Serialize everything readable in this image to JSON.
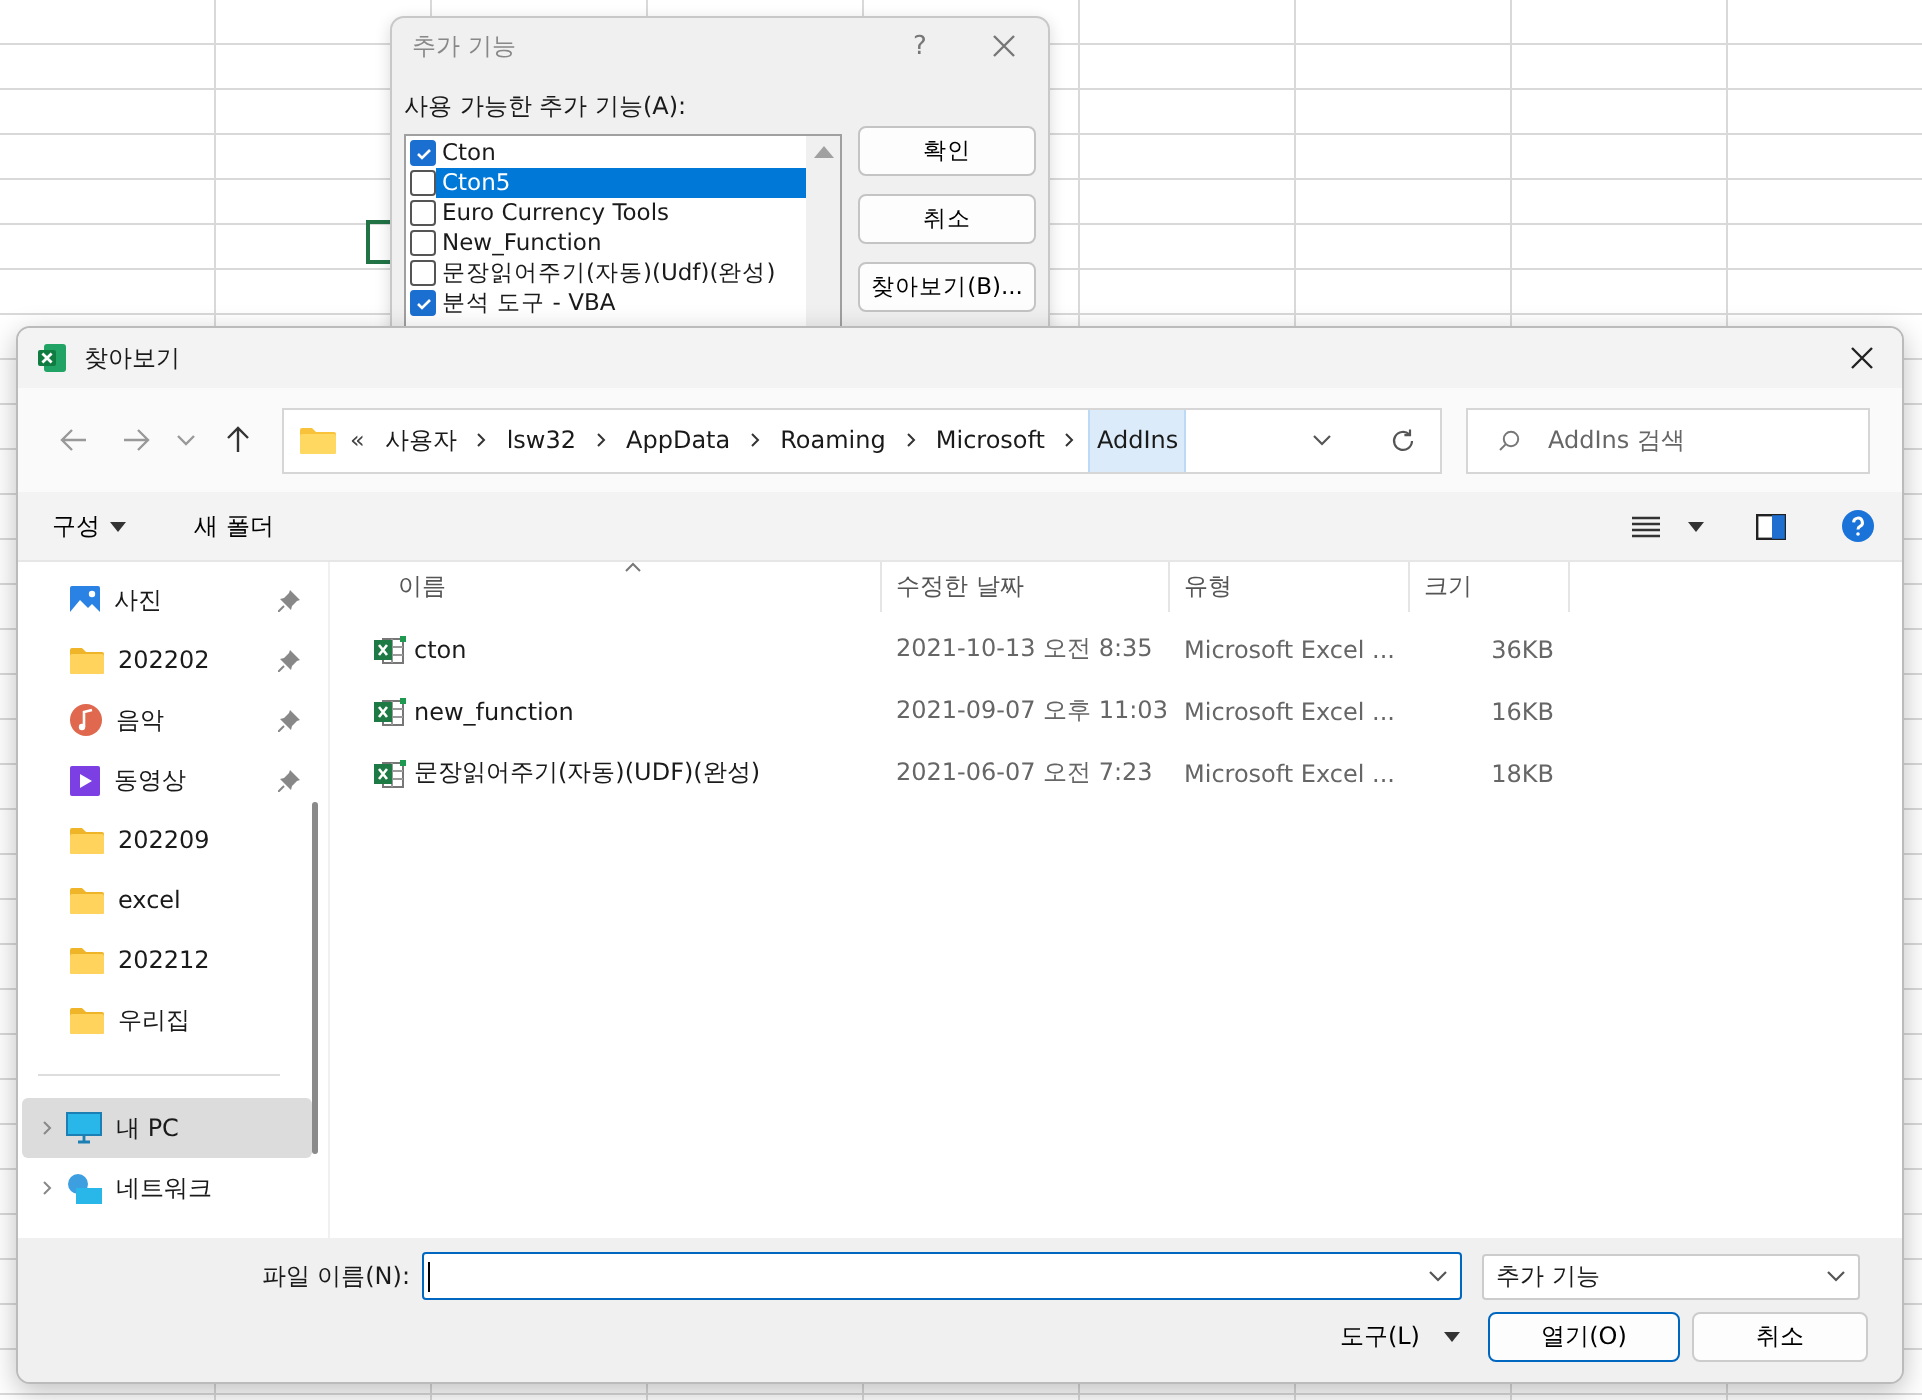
{
  "addin_dialog": {
    "title": "추가 기능",
    "help": "?",
    "list_label": "사용 가능한 추가 기능(A):",
    "items": [
      {
        "label": "Cton",
        "checked": true,
        "selected": false
      },
      {
        "label": "Cton5",
        "checked": false,
        "selected": true
      },
      {
        "label": "Euro Currency Tools",
        "checked": false,
        "selected": false
      },
      {
        "label": "New_Function",
        "checked": false,
        "selected": false
      },
      {
        "label": "문장읽어주기(자동)(Udf)(완성)",
        "checked": false,
        "selected": false
      },
      {
        "label": "분석 도구 - VBA",
        "checked": true,
        "selected": false
      }
    ],
    "buttons": [
      "확인",
      "취소",
      "찾아보기(B)..."
    ]
  },
  "file_dialog": {
    "title": "찾아보기",
    "overflow": "«",
    "breadcrumb": [
      {
        "label": "사용자",
        "highlighted": false
      },
      {
        "label": "lsw32",
        "highlighted": false
      },
      {
        "label": "AppData",
        "highlighted": false
      },
      {
        "label": "Roaming",
        "highlighted": false
      },
      {
        "label": "Microsoft",
        "highlighted": false
      },
      {
        "label": "AddIns",
        "highlighted": true
      }
    ],
    "search": {
      "placeholder": "AddIns 검색"
    },
    "toolbar": {
      "organize": "구성",
      "new_folder": "새 폴더"
    },
    "sidebar": [
      {
        "label": "사진",
        "kind": "pictures",
        "pinned": true,
        "selected": false
      },
      {
        "label": "202202",
        "kind": "folder",
        "pinned": true,
        "selected": false
      },
      {
        "label": "음악",
        "kind": "music",
        "pinned": true,
        "selected": false
      },
      {
        "label": "동영상",
        "kind": "video",
        "pinned": true,
        "selected": false
      },
      {
        "label": "202209",
        "kind": "folder",
        "pinned": false,
        "selected": false
      },
      {
        "label": "excel",
        "kind": "folder",
        "pinned": false,
        "selected": false
      },
      {
        "label": "202212",
        "kind": "folder",
        "pinned": false,
        "selected": false
      },
      {
        "label": "우리집",
        "kind": "folder",
        "pinned": false,
        "selected": false
      },
      {
        "label": "내 PC",
        "kind": "pc",
        "pinned": false,
        "selected": true
      },
      {
        "label": "네트워크",
        "kind": "network",
        "pinned": false,
        "selected": false
      }
    ],
    "columns": [
      "이름",
      "수정한 날짜",
      "유형",
      "크기"
    ],
    "rows": [
      {
        "name": "cton",
        "date": "2021-10-13 오전 8:35",
        "type": "Microsoft Excel ...",
        "size": "36KB"
      },
      {
        "name": "new_function",
        "date": "2021-09-07 오후 11:03",
        "type": "Microsoft Excel ...",
        "size": "16KB"
      },
      {
        "name": "문장읽어주기(자동)(UDF)(완성)",
        "date": "2021-06-07 오전 7:23",
        "type": "Microsoft Excel ...",
        "size": "18KB"
      }
    ],
    "filename_label": "파일 이름(N):",
    "filetype": "추가 기능",
    "tools": "도구(L)",
    "buttons": [
      "열기(O)",
      "취소"
    ]
  }
}
